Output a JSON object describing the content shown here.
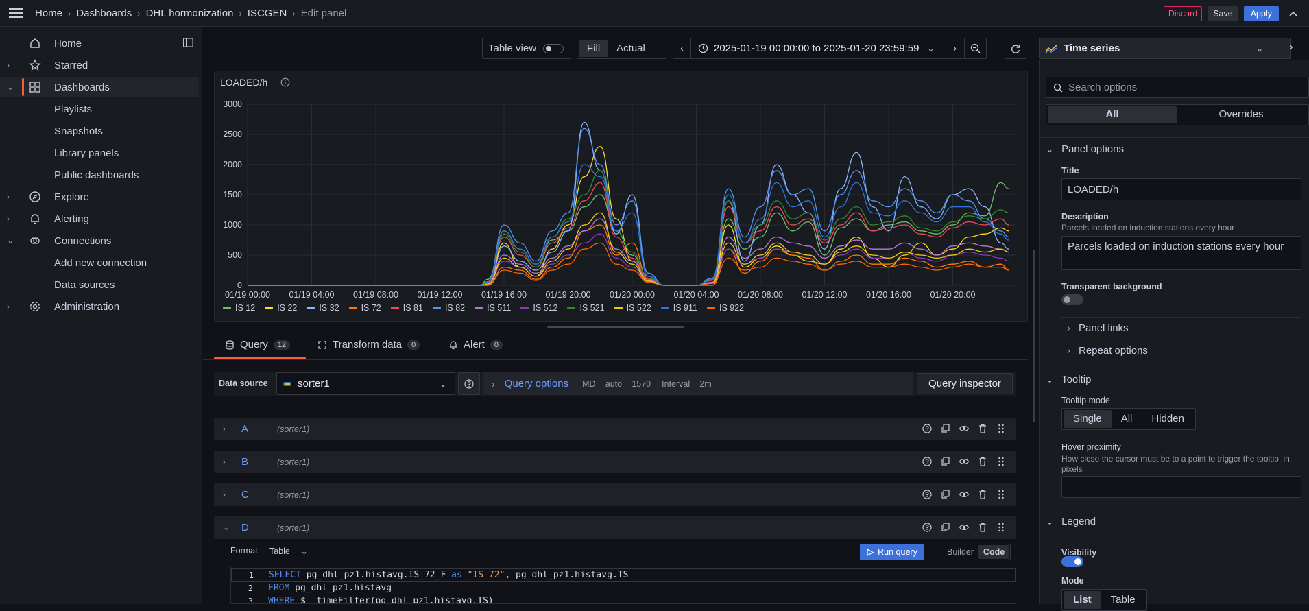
{
  "breadcrumb": [
    "Home",
    "Dashboards",
    "DHL hormonization",
    "ISCGEN",
    "Edit panel"
  ],
  "topbar": {
    "discard": "Discard",
    "save": "Save",
    "apply": "Apply"
  },
  "sidebar": {
    "items": [
      {
        "label": "Home",
        "icon": "home-icon"
      },
      {
        "label": "Starred",
        "icon": "star-icon"
      },
      {
        "label": "Dashboards",
        "icon": "dashboards-grid-icon"
      },
      {
        "label": "Explore",
        "icon": "compass-icon"
      },
      {
        "label": "Alerting",
        "icon": "bell-icon"
      },
      {
        "label": "Connections",
        "icon": "connections-icon"
      },
      {
        "label": "Administration",
        "icon": "gear-icon"
      }
    ],
    "dashboards_sub": [
      "Playlists",
      "Snapshots",
      "Library panels",
      "Public dashboards"
    ],
    "connections_sub": [
      "Add new connection",
      "Data sources"
    ]
  },
  "toolbar": {
    "table_view": "Table view",
    "fill": "Fill",
    "actual": "Actual",
    "time_range": "2025-01-19 00:00:00 to 2025-01-20 23:59:59",
    "viz_type": "Time series"
  },
  "panel": {
    "title": "LOADED/h"
  },
  "chart_data": {
    "type": "line",
    "title": "LOADED/h",
    "ylim": [
      0,
      3000
    ],
    "y_ticks": [
      "3000",
      "2500",
      "2000",
      "1500",
      "1000",
      "500",
      "0"
    ],
    "x_ticks": [
      "01/19 00:00",
      "01/19 04:00",
      "01/19 08:00",
      "01/19 12:00",
      "01/19 16:00",
      "01/19 20:00",
      "01/20 00:00",
      "01/20 04:00",
      "01/20 08:00",
      "01/20 12:00",
      "01/20 16:00",
      "01/20 20:00"
    ],
    "grid": true,
    "legend_position": "bottom",
    "x_hours": [
      0,
      14.5,
      15,
      16,
      17,
      18,
      19,
      20,
      21,
      22,
      23,
      24,
      25,
      26,
      27,
      28,
      29,
      30,
      31,
      32,
      33,
      34,
      35,
      36,
      37,
      38,
      39,
      40,
      41,
      42,
      43,
      44,
      45,
      46,
      47,
      47.5
    ],
    "series": [
      {
        "name": "IS 12",
        "color": "#73bf69",
        "values": [
          0,
          0,
          100,
          900,
          600,
          350,
          750,
          900,
          1300,
          1500,
          900,
          500,
          150,
          0,
          0,
          0,
          100,
          1100,
          600,
          800,
          1200,
          900,
          1050,
          500,
          950,
          1100,
          900,
          1000,
          1050,
          900,
          850,
          1000,
          1200,
          1150,
          1700,
          1600
        ]
      },
      {
        "name": "IS 22",
        "color": "#fade2a",
        "values": [
          0,
          0,
          50,
          700,
          300,
          150,
          600,
          1000,
          1800,
          2300,
          1100,
          400,
          100,
          0,
          0,
          0,
          50,
          1000,
          300,
          450,
          650,
          500,
          400,
          350,
          600,
          800,
          450,
          300,
          500,
          700,
          500,
          600,
          800,
          850,
          950,
          900
        ]
      },
      {
        "name": "IS 32",
        "color": "#8ab8ff",
        "values": [
          0,
          0,
          0,
          650,
          400,
          250,
          550,
          900,
          2700,
          1900,
          850,
          1500,
          200,
          0,
          0,
          0,
          100,
          1400,
          400,
          1000,
          2000,
          1500,
          1200,
          600,
          1600,
          2200,
          1300,
          900,
          1800,
          1300,
          1100,
          1500,
          1600,
          1300,
          700,
          600
        ]
      },
      {
        "name": "IS 72",
        "color": "#ff780a",
        "values": [
          0,
          0,
          0,
          300,
          250,
          100,
          300,
          450,
          900,
          1000,
          500,
          700,
          100,
          0,
          0,
          0,
          0,
          600,
          200,
          400,
          600,
          500,
          450,
          250,
          400,
          500,
          350,
          350,
          450,
          400,
          300,
          350,
          400,
          300,
          350,
          250
        ]
      },
      {
        "name": "IS 81",
        "color": "#f2495c",
        "values": [
          0,
          0,
          30,
          800,
          500,
          300,
          700,
          950,
          1400,
          1700,
          800,
          450,
          100,
          0,
          0,
          0,
          80,
          1300,
          700,
          900,
          1300,
          1000,
          1100,
          700,
          1000,
          1200,
          900,
          950,
          1000,
          850,
          800,
          950,
          1050,
          1000,
          1100,
          1000
        ]
      },
      {
        "name": "IS 82",
        "color": "#5794f2",
        "values": [
          0,
          0,
          60,
          1000,
          700,
          400,
          900,
          1200,
          2600,
          2000,
          1000,
          1400,
          200,
          0,
          0,
          0,
          120,
          1600,
          800,
          1300,
          1900,
          1500,
          1600,
          900,
          1500,
          1900,
          1400,
          1300,
          1600,
          1400,
          1200,
          1500,
          1400,
          1100,
          900,
          800
        ]
      },
      {
        "name": "IS 511",
        "color": "#b877d9",
        "values": [
          0,
          0,
          20,
          500,
          350,
          200,
          450,
          650,
          900,
          1100,
          600,
          400,
          80,
          0,
          0,
          0,
          50,
          800,
          450,
          600,
          800,
          700,
          650,
          450,
          650,
          750,
          600,
          600,
          700,
          600,
          500,
          650,
          700,
          650,
          600,
          550
        ]
      },
      {
        "name": "IS 512",
        "color": "#8f3bb8",
        "values": [
          0,
          0,
          10,
          400,
          300,
          150,
          350,
          500,
          700,
          850,
          450,
          300,
          60,
          0,
          0,
          0,
          40,
          600,
          350,
          450,
          600,
          550,
          500,
          350,
          500,
          600,
          450,
          450,
          550,
          450,
          400,
          500,
          550,
          500,
          450,
          400
        ]
      },
      {
        "name": "IS 521",
        "color": "#37872d",
        "values": [
          0,
          0,
          40,
          850,
          550,
          300,
          800,
          1100,
          1500,
          1900,
          900,
          550,
          120,
          0,
          0,
          0,
          90,
          1400,
          700,
          1000,
          1400,
          1100,
          1200,
          750,
          1100,
          1300,
          1000,
          1050,
          1150,
          950,
          900,
          1050,
          1150,
          1100,
          1250,
          1200
        ]
      },
      {
        "name": "IS 522",
        "color": "#f2cc0c",
        "values": [
          0,
          0,
          20,
          450,
          300,
          150,
          400,
          600,
          1000,
          1200,
          550,
          350,
          70,
          0,
          0,
          0,
          40,
          700,
          350,
          500,
          700,
          550,
          500,
          350,
          550,
          650,
          500,
          450,
          550,
          500,
          450,
          500,
          600,
          550,
          600,
          550
        ]
      },
      {
        "name": "IS 911",
        "color": "#3274d9",
        "values": [
          0,
          0,
          50,
          900,
          600,
          350,
          800,
          1050,
          2000,
          1800,
          900,
          1200,
          150,
          0,
          0,
          0,
          100,
          1500,
          700,
          1100,
          1700,
          1300,
          1400,
          800,
          1300,
          1700,
          1200,
          1150,
          1400,
          1200,
          1050,
          1300,
          1300,
          1050,
          850,
          750
        ]
      },
      {
        "name": "IS 922",
        "color": "#fa6400",
        "values": [
          0,
          0,
          10,
          250,
          200,
          80,
          250,
          350,
          600,
          700,
          350,
          250,
          50,
          0,
          0,
          0,
          30,
          450,
          250,
          300,
          450,
          400,
          350,
          250,
          350,
          400,
          300,
          300,
          350,
          300,
          250,
          300,
          350,
          300,
          300,
          250
        ]
      }
    ]
  },
  "tabs": [
    {
      "label": "Query",
      "count": "12"
    },
    {
      "label": "Transform data",
      "count": "0"
    },
    {
      "label": "Alert",
      "count": "0"
    }
  ],
  "querybar": {
    "ds_label": "Data source",
    "ds_value": "sorter1",
    "query_options": "Query options",
    "md": "MD = auto = 1570",
    "interval": "Interval = 2m",
    "inspector": "Query inspector"
  },
  "queries": [
    {
      "letter": "A",
      "ds": "(sorter1)"
    },
    {
      "letter": "B",
      "ds": "(sorter1)"
    },
    {
      "letter": "C",
      "ds": "(sorter1)"
    },
    {
      "letter": "D",
      "ds": "(sorter1)"
    }
  ],
  "queryD": {
    "format_label": "Format:",
    "format_value": "Table",
    "run": "Run query",
    "builder": "Builder",
    "code": "Code"
  },
  "code_lines": [
    {
      "n": "1",
      "kw": "SELECT",
      "rest": " pg_dhl_pz1.histavg.IS_72_F ",
      "kw2": "as",
      "str": " \"IS 72\"",
      "rest2": ", pg_dhl_pz1.histavg.TS"
    },
    {
      "n": "2",
      "kw": "FROM",
      "rest": " pg_dhl_pz1.histavg",
      "kw2": "",
      "str": "",
      "rest2": ""
    },
    {
      "n": "3",
      "kw": "WHERE",
      "rest": " $__timeFilter(pg_dhl_pz1.histavg.TS)",
      "kw2": "",
      "str": "",
      "rest2": ""
    }
  ],
  "options": {
    "search_placeholder": "Search options",
    "all": "All",
    "overrides": "Overrides",
    "panel_options": "Panel options",
    "title_label": "Title",
    "title_value": "LOADED/h",
    "desc_label": "Description",
    "desc_hint": "Parcels loaded on induction stations every hour",
    "desc_value": "Parcels loaded on induction stations every hour",
    "transparent": "Transparent background",
    "panel_links": "Panel links",
    "repeat": "Repeat options",
    "tooltip": "Tooltip",
    "tooltip_mode": "Tooltip mode",
    "modes": [
      "Single",
      "All",
      "Hidden"
    ],
    "hover": "Hover proximity",
    "hover_desc": "How close the cursor must be to a point to trigger the tooltip, in pixels",
    "legend": "Legend",
    "visibility": "Visibility",
    "mode": "Mode",
    "list": "List",
    "table": "Table"
  }
}
